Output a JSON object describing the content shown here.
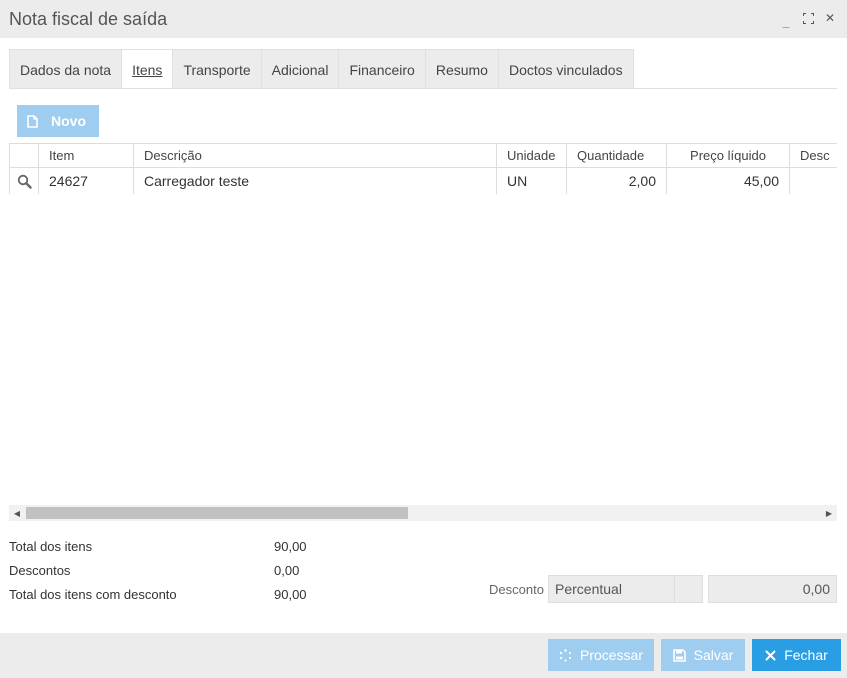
{
  "window": {
    "title": "Nota fiscal de saída",
    "controls": {
      "minimize": "_",
      "maximize": "⛶",
      "close": "✕"
    }
  },
  "tabs": [
    {
      "label": "Dados da nota",
      "active": false
    },
    {
      "label": "Itens",
      "active": true
    },
    {
      "label": "Transporte",
      "active": false
    },
    {
      "label": "Adicional",
      "active": false
    },
    {
      "label": "Financeiro",
      "active": false
    },
    {
      "label": "Resumo",
      "active": false
    },
    {
      "label": "Doctos vinculados",
      "active": false
    }
  ],
  "toolbar": {
    "novo_label": "Novo",
    "novo_icon": "document-icon"
  },
  "grid": {
    "columns": [
      "",
      "Item",
      "Descrição",
      "Unidade",
      "Quantidade",
      "Preço líquido",
      "Desc"
    ],
    "rows": [
      {
        "item": "24627",
        "descricao": "Carregador teste",
        "unidade": "UN",
        "quantidade": "2,00",
        "preco": "45,00"
      }
    ]
  },
  "totals": {
    "total_itens_label": "Total dos itens",
    "total_itens_value": "90,00",
    "descontos_label": "Descontos",
    "descontos_value": "0,00",
    "total_com_desconto_label": "Total dos itens com desconto",
    "total_com_desconto_value": "90,00"
  },
  "desconto": {
    "label": "Desconto",
    "type_value": "Percentual",
    "amount_value": "0,00"
  },
  "footer": {
    "processar_label": "Processar",
    "salvar_label": "Salvar",
    "fechar_label": "Fechar"
  },
  "colors": {
    "primary": "#2a9ee5",
    "disabled": "#9fcdef",
    "panel": "#ececec"
  }
}
